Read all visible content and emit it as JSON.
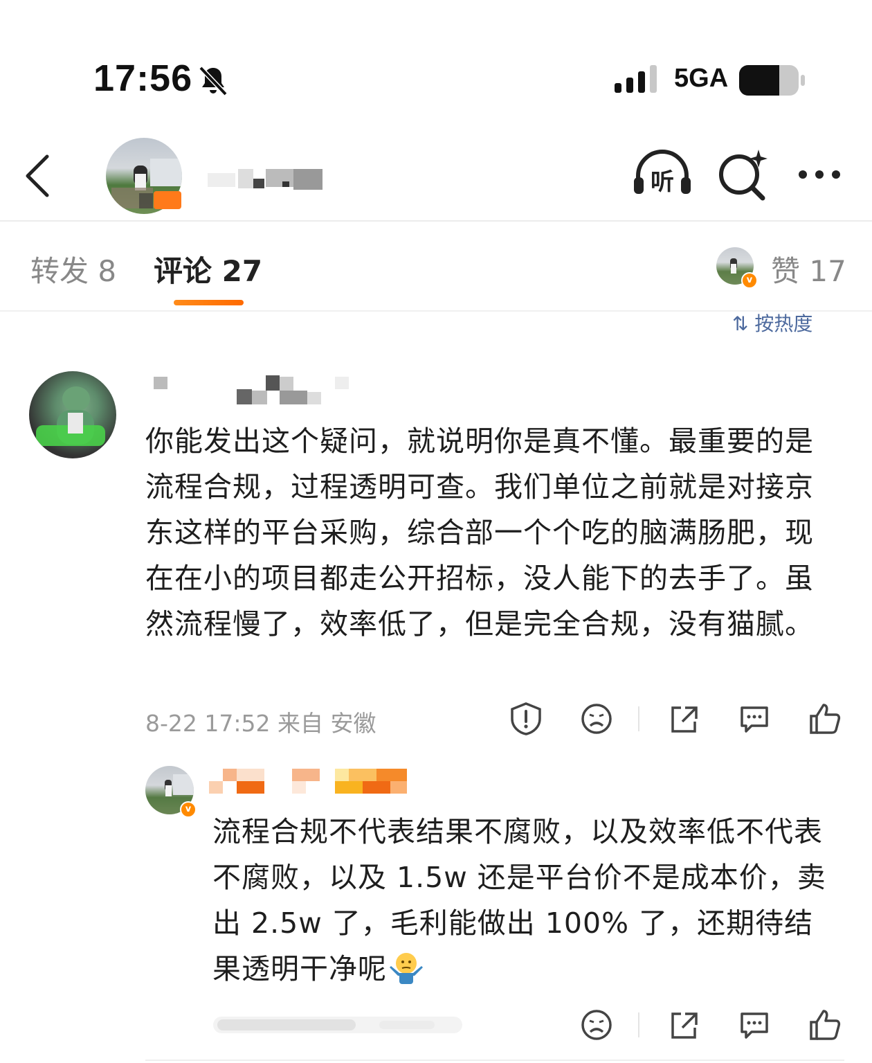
{
  "status_bar": {
    "time": "17:56",
    "network": "5GA",
    "icons": [
      "bell-slash-icon",
      "signal-bars-icon",
      "battery-icon"
    ]
  },
  "header": {
    "icons": [
      "back-chevron-icon",
      "listen-headphones-icon",
      "search-sparkle-icon",
      "more-dots-icon"
    ],
    "listen_label": "听"
  },
  "tabs": {
    "repost": "转发 8",
    "comments": "评论 27",
    "likes": "赞 17"
  },
  "sort_label": "按热度",
  "comment": {
    "text": "你能发出这个疑问，就说明你是真不懂。最重要的是流程合规，过程透明可查。我们单位之前就是对接京东这样的平台采购，综合部一个个吃的脑满肠肥，现在在小的项目都走公开招标，没人能下的去手了。虽然流程慢了，效率低了，但是完全合规，没有猫腻。",
    "meta": "8-22 17:52  来自 安徽",
    "actions": [
      "report-icon",
      "dislike-face-icon",
      "share-icon",
      "comment-icon",
      "like-thumb-icon"
    ]
  },
  "reply": {
    "text": "流程合规不代表结果不腐败，以及效率低不代表不腐败，以及 1.5w 还是平台价不是成本价，卖出 2.5w 了，毛利能做出 100% 了，还期待结果透明干净呢",
    "emoji": "shrug-emoji",
    "actions": [
      "dislike-face-icon",
      "share-icon",
      "comment-icon",
      "like-thumb-icon"
    ]
  },
  "colors": {
    "accent": "#ff7a1a",
    "link": "#4d6a9e",
    "muted": "#9a9a9a"
  }
}
